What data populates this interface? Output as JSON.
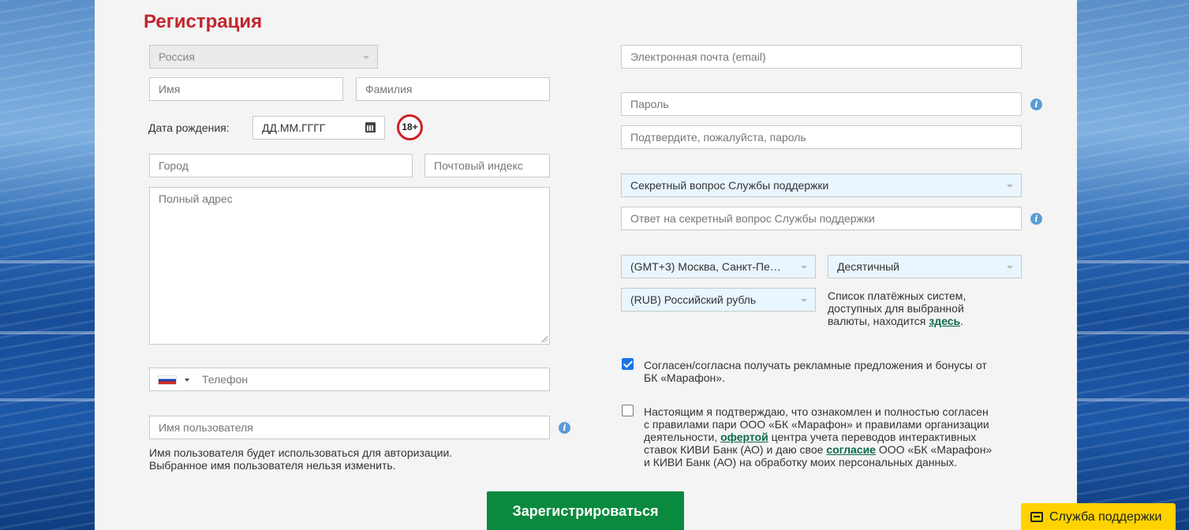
{
  "page": {
    "title": "Регистрация"
  },
  "left": {
    "country": "Россия",
    "first_name_placeholder": "Имя",
    "last_name_placeholder": "Фамилия",
    "dob_label": "Дата рождения:",
    "dob_placeholder": "ДД.ММ.ГГГГ",
    "age_badge": "18+",
    "city_placeholder": "Город",
    "zip_placeholder": "Почтовый индекс",
    "address_placeholder": "Полный адрес",
    "phone_placeholder": "Телефон",
    "username_placeholder": "Имя пользователя",
    "username_hint_1": "Имя пользователя будет использоваться для авторизации.",
    "username_hint_2": "Выбранное имя пользователя нельзя изменить."
  },
  "right": {
    "email_placeholder": "Электронная почта (email)",
    "password_placeholder": "Пароль",
    "confirm_password_placeholder": "Подтвердите, пожалуйста, пароль",
    "secret_question": "Секретный вопрос Службы поддержки",
    "secret_answer_placeholder": "Ответ на секретный вопрос Службы поддержки",
    "timezone": "(GMT+3) Москва, Санкт-Пе…",
    "odds_format": "Десятичный",
    "currency": "(RUB) Российский рубль",
    "payment_note_1": "Список платёжных систем,",
    "payment_note_2": "доступных для выбранной",
    "payment_note_3": "валюты, находится",
    "payment_note_link": "здесь",
    "payment_note_end": "."
  },
  "consents": {
    "marketing_checked": true,
    "marketing_line_1": "Согласен/согласна получать рекламные предложения и бонусы от",
    "marketing_line_2": "БК «Марафон».",
    "terms_checked": false,
    "terms_line_1": "Настоящим я подтверждаю, что ознакомлен и полностью согласен",
    "terms_line_2": "с правилами пари ООО «БК «Марафон» и правилами организации",
    "terms_line_3_pre": "деятельности,",
    "terms_line_3_link": "офертой",
    "terms_line_3_post": "центра учета переводов интерактивных",
    "terms_line_4_pre": "ставок КИВИ Банк (АО) и даю свое",
    "terms_line_4_link": "согласие",
    "terms_line_4_post": "ООО «БК «Марафон»",
    "terms_line_5": "и КИВИ Банк (АО) на обработку моих персональных данных."
  },
  "buttons": {
    "register": "Зарегистрироваться",
    "support": "Служба поддержки"
  },
  "colors": {
    "title": "#c0262d",
    "primary_button": "#0a8a3e",
    "support_button": "#ffd200",
    "select_bg": "#e9f6ff",
    "link": "#0b6a4b"
  }
}
